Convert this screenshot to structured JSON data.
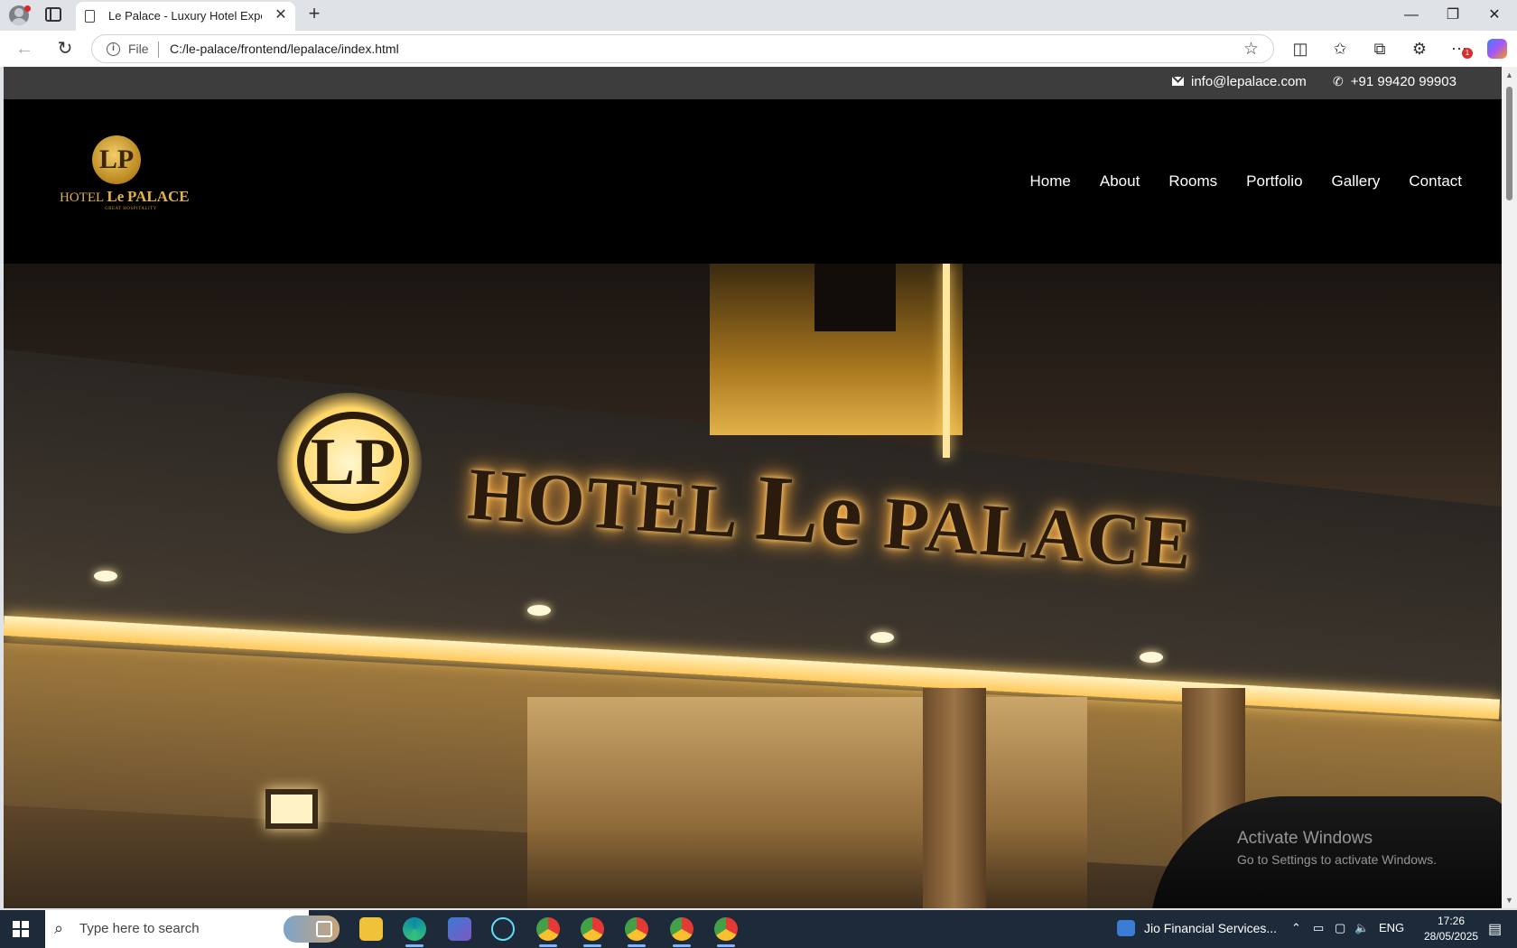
{
  "browser": {
    "tab_title": "Le Palace - Luxury Hotel Experience",
    "url_scheme": "File",
    "url": "C:/le-palace/frontend/lepalace/index.html",
    "extension_badge": "1"
  },
  "page": {
    "topbar": {
      "email": "info@lepalace.com",
      "phone": "+91 99420 99903"
    },
    "logo": {
      "monogram": "LP",
      "hotel": "HOTEL",
      "name_le": "Le",
      "name_palace": "PALACE",
      "tagline": "GREAT HOSPITALITY"
    },
    "nav": [
      "Home",
      "About",
      "Rooms",
      "Portfolio",
      "Gallery",
      "Contact"
    ],
    "hero_sign": {
      "monogram": "LP",
      "hotel": "HOTEL",
      "le": "Le",
      "palace": "PALACE"
    }
  },
  "watermark": {
    "line1": "Activate Windows",
    "line2": "Go to Settings to activate Windows."
  },
  "taskbar": {
    "search_placeholder": "Type here to search",
    "notification": "Jio Financial Services...",
    "language": "ENG",
    "time": "17:26",
    "date": "28/05/2025",
    "notification_count": "1"
  },
  "colors": {
    "gold": "#e0b14b",
    "topbar_bg": "#3d3d3d",
    "header_bg": "#000000"
  }
}
